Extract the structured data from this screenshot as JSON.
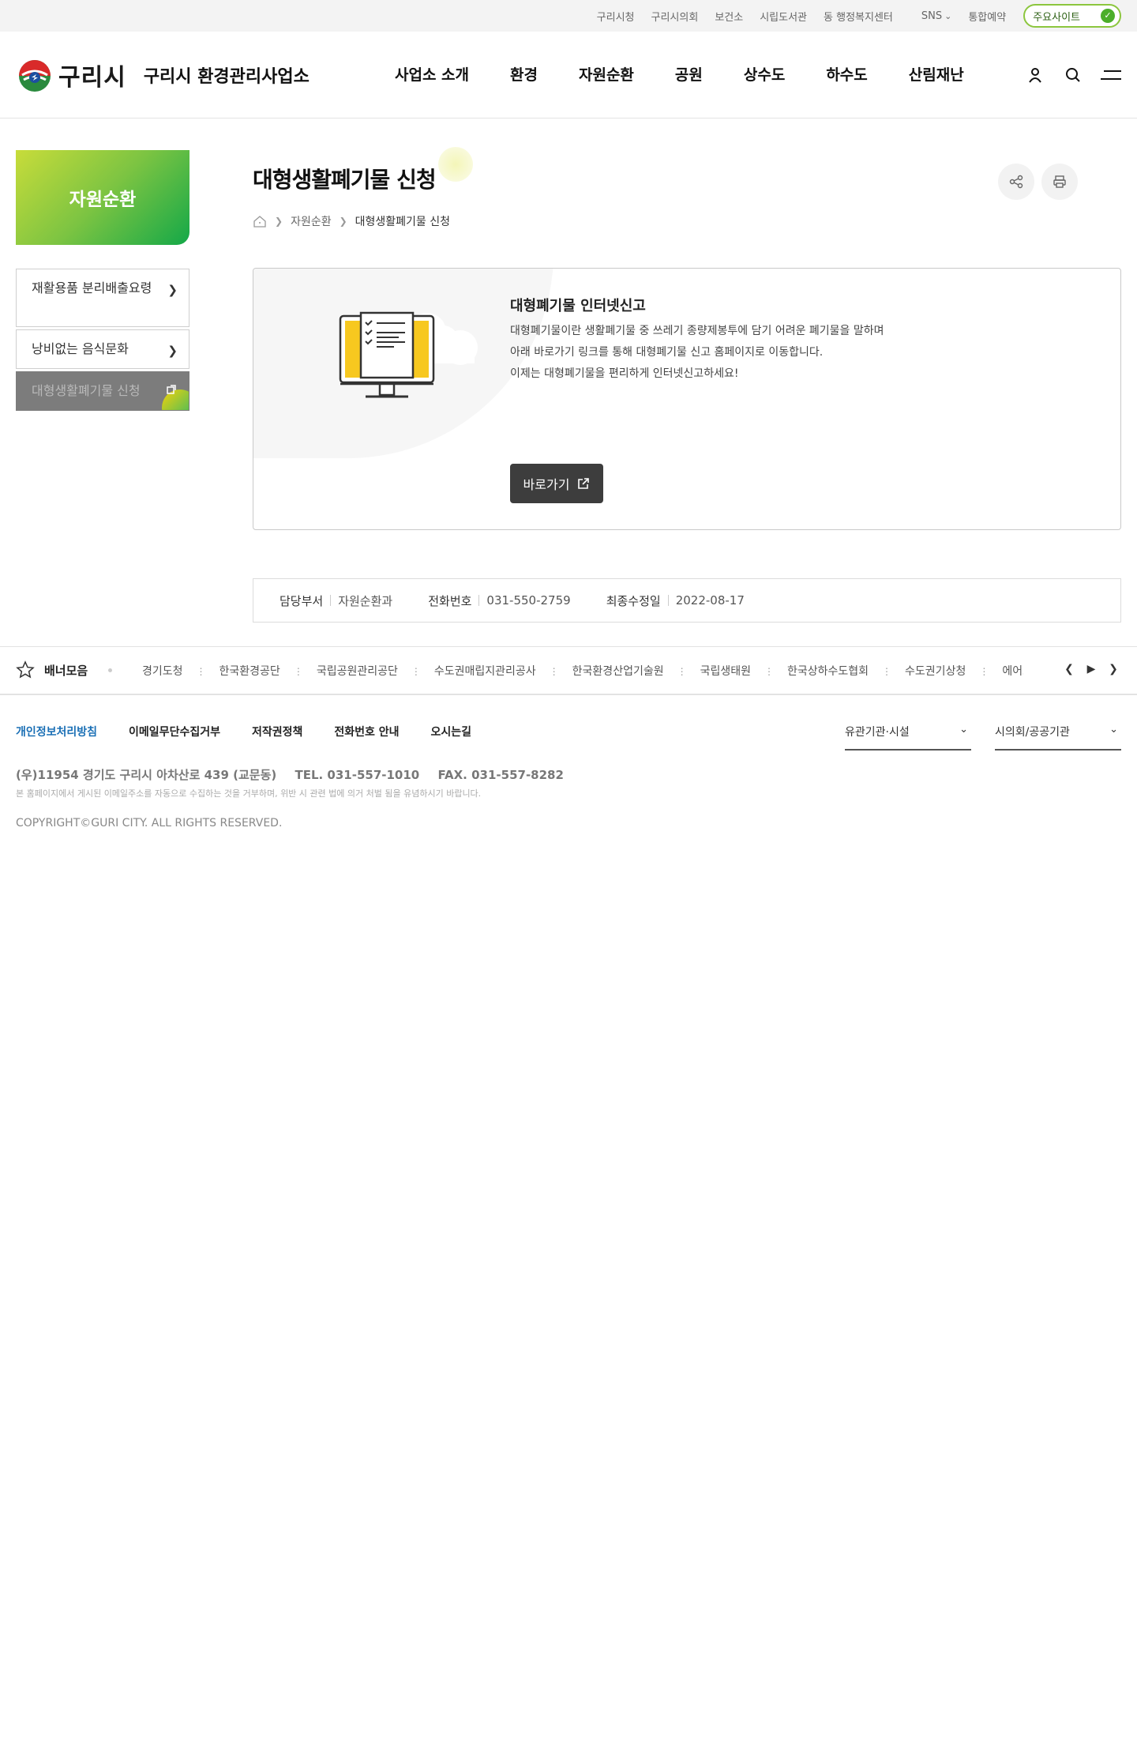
{
  "utility": {
    "links": [
      "구리시청",
      "구리시의회",
      "보건소",
      "시립도서관",
      "동 행정복지센터"
    ],
    "sns": "SNS",
    "reservation": "통합예약",
    "main_sites": "주요사이트"
  },
  "header": {
    "city": "구리시",
    "org": "구리시 환경관리사업소",
    "nav": [
      "사업소 소개",
      "환경",
      "자원순환",
      "공원",
      "상수도",
      "하수도",
      "산림재난"
    ]
  },
  "sidebar": {
    "title": "자원순환",
    "items": [
      {
        "label": "재활용품 분리배출요령"
      },
      {
        "label": "낭비없는 음식문화"
      },
      {
        "label": "대형생활폐기물 신청"
      }
    ]
  },
  "page": {
    "title": "대형생활폐기물 신청",
    "breadcrumb": [
      "자원순환",
      "대형생활폐기물 신청"
    ]
  },
  "card": {
    "title": "대형폐기물 인터넷신고",
    "lines": [
      "대형폐기물이란 생활폐기물 중 쓰레기 종량제봉투에 담기 어려운 폐기물을 말하며",
      "아래 바로가기 링크를 통해 대형폐기물 신고 홈페이지로 이동합니다.",
      "이제는 대형폐기물을 편리하게 인터넷신고하세요!"
    ],
    "button": "바로가기"
  },
  "meta": {
    "dept_label": "담당부서",
    "dept": "자원순환과",
    "phone_label": "전화번호",
    "phone": "031-550-2759",
    "updated_label": "최종수정일",
    "updated": "2022-08-17"
  },
  "banner": {
    "title": "배너모음",
    "items": [
      "경기도청",
      "한국환경공단",
      "국립공원관리공단",
      "수도권매립지관리공사",
      "한국환경산업기술원",
      "국립생태원",
      "한국상하수도협회",
      "수도권기상청",
      "에어코리아"
    ]
  },
  "footer": {
    "links": [
      "개인정보처리방침",
      "이메일무단수집거부",
      "저작권정책",
      "전화번호 안내",
      "오시는길"
    ],
    "select1": "유관기관·시설",
    "select2": "시의회/공공기관",
    "address": "(우)11954 경기도 구리시 아차산로 439 (교문동)",
    "tel": "TEL. 031-557-1010",
    "fax": "FAX. 031-557-8282",
    "notice": "본 홈페이지에서 게시된 이메일주소를 자동으로 수집하는 것을 거부하며, 위반 시 관련 법에 의거 처벌 됨을 유념하시기 바랍니다.",
    "copyright": "COPYRIGHT©GURI CITY. ALL RIGHTS RESERVED."
  },
  "colors": {
    "accent_green": "#14a848",
    "lime": "#c8dc3a",
    "button_dark": "#3d3d3d",
    "link_blue": "#1a6fb5"
  },
  "icons": [
    "user-icon",
    "search-icon",
    "menu-icon",
    "share-icon",
    "print-icon",
    "home-icon",
    "external-link-icon",
    "star-icon"
  ]
}
